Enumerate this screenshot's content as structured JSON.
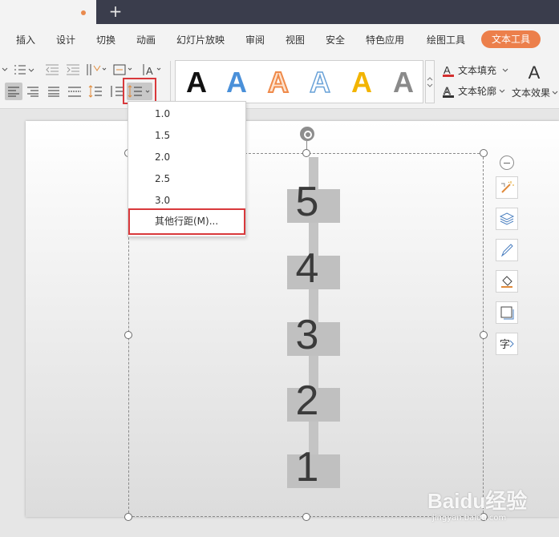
{
  "colors": {
    "accent": "#ec7f4b",
    "highlight_border": "#d9393c",
    "titlebar": "#3a3d4c"
  },
  "titlebar": {
    "new_tab_icon": "plus-icon",
    "new_tab_symbol": "+"
  },
  "menubar": {
    "items": [
      "插入",
      "设计",
      "切换",
      "动画",
      "幻灯片放映",
      "审阅",
      "视图",
      "安全",
      "特色应用",
      "绘图工具"
    ],
    "active": "文本工具"
  },
  "toolbar": {
    "text_styles": [
      {
        "letter": "A",
        "style": "black-solid",
        "color": "#111111"
      },
      {
        "letter": "A",
        "style": "blue-solid",
        "color": "#4a90d9"
      },
      {
        "letter": "A",
        "style": "orange-outline",
        "color": "#ef8a4a"
      },
      {
        "letter": "A",
        "style": "blue-outline",
        "color": "#6aa2d8"
      },
      {
        "letter": "A",
        "style": "yellow-solid",
        "color": "#f2b400"
      },
      {
        "letter": "A",
        "style": "gray-gradient",
        "color": "#8a8a8a"
      }
    ],
    "text_fill": "文本填充",
    "text_outline": "文本轮廓",
    "text_effect": "文本效果",
    "text_effect_icon_letter": "A"
  },
  "line_spacing_menu": {
    "options": [
      "1.0",
      "1.5",
      "2.0",
      "2.5",
      "3.0"
    ],
    "other": "其他行距(M)..."
  },
  "slide": {
    "numbers": [
      "5",
      "4",
      "3",
      "2",
      "1"
    ]
  },
  "watermark": {
    "main": "Baidu经验",
    "sub": "jingyan.baidu.com"
  }
}
